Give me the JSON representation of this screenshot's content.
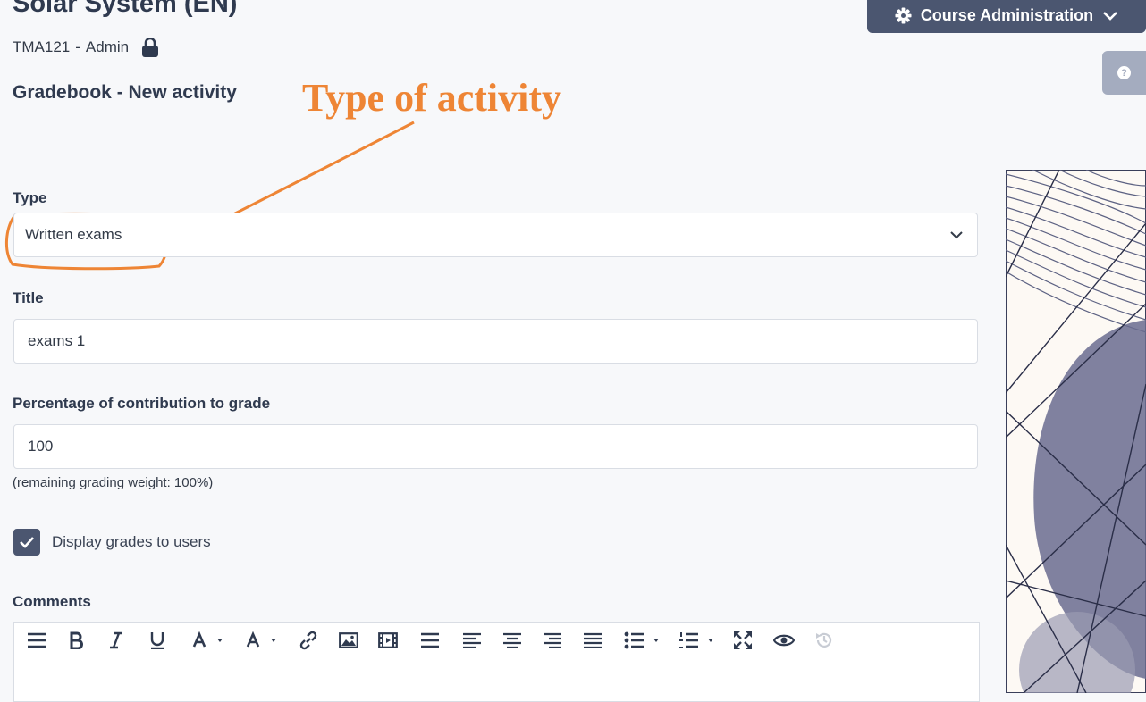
{
  "header": {
    "course_title": "Solar System (EN)",
    "course_code": "TMA121",
    "separator": "-",
    "role": "Admin",
    "page_subtitle": "Gradebook - New activity",
    "admin_button_label": "Course Administration",
    "help_glyph": "?"
  },
  "annotation": {
    "text": "Type of activity",
    "color": "#ee8535"
  },
  "form": {
    "type_label": "Type",
    "type_value": "Written exams",
    "title_label": "Title",
    "title_value": "exams 1",
    "percentage_label": "Percentage of contribution to grade",
    "percentage_value": "100",
    "remaining_hint": "(remaining grading weight: 100%)",
    "display_grades_label": "Display grades to users",
    "display_grades_checked": true,
    "comments_label": "Comments"
  },
  "toolbar": {
    "icons": [
      "menu-icon",
      "bold-icon",
      "italic-icon",
      "underline-icon",
      "font-color-icon",
      "highlight-color-icon",
      "link-icon",
      "image-icon",
      "video-icon",
      "horizontal-rule-icon",
      "align-left-icon",
      "align-center-icon",
      "align-right-icon",
      "align-justify-icon",
      "bullet-list-icon",
      "numbered-list-icon",
      "fullscreen-icon",
      "preview-icon",
      "history-icon"
    ]
  },
  "colors": {
    "primary": "#4b5670",
    "text": "#2f3a4f",
    "help": "#a4acbf"
  }
}
